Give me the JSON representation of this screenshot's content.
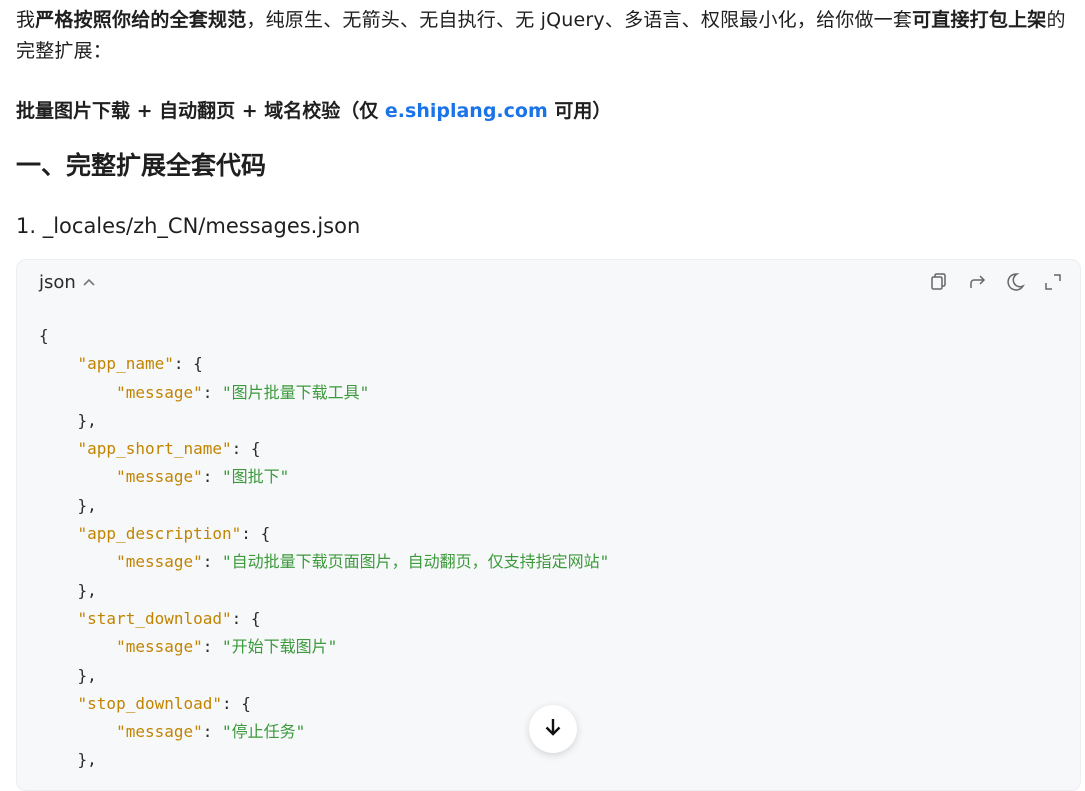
{
  "intro": {
    "p1": "我",
    "b1": "严格按照你给的全套规范",
    "p2": "，纯原生、无箭头、无自执行、无 jQuery、多语言、权限最小化，给你做一套",
    "b2": "可直接打包上架",
    "p3": "的完整扩展："
  },
  "subtitle": {
    "text": "批量图片下载 + 自动翻页 + 域名校验（仅 ",
    "link": "e.shiplang.com",
    "suffix": " 可用）"
  },
  "section_title": "一、完整扩展全套代码",
  "file_heading": "1. _locales/zh_CN/messages.json",
  "code_block": {
    "language": "json",
    "toolbar": {
      "copy_icon": "copy-icon",
      "share_icon": "share-icon",
      "theme_icon": "moon-icon",
      "expand_icon": "expand-icon"
    },
    "entries": [
      {
        "key": "app_name",
        "message": "图片批量下载工具"
      },
      {
        "key": "app_short_name",
        "message": "图批下"
      },
      {
        "key": "app_description",
        "message": "自动批量下载页面图片，自动翻页，仅支持指定网站"
      },
      {
        "key": "start_download",
        "message": "开始下载图片"
      },
      {
        "key": "stop_download",
        "message": "停止任务"
      }
    ],
    "message_key": "message"
  },
  "scroll_button_icon": "arrow-down-icon",
  "colors": {
    "link": "#1a73e8",
    "json_key": "#c18401",
    "json_string": "#3c9a3c",
    "code_bg": "#f7f8fa"
  }
}
